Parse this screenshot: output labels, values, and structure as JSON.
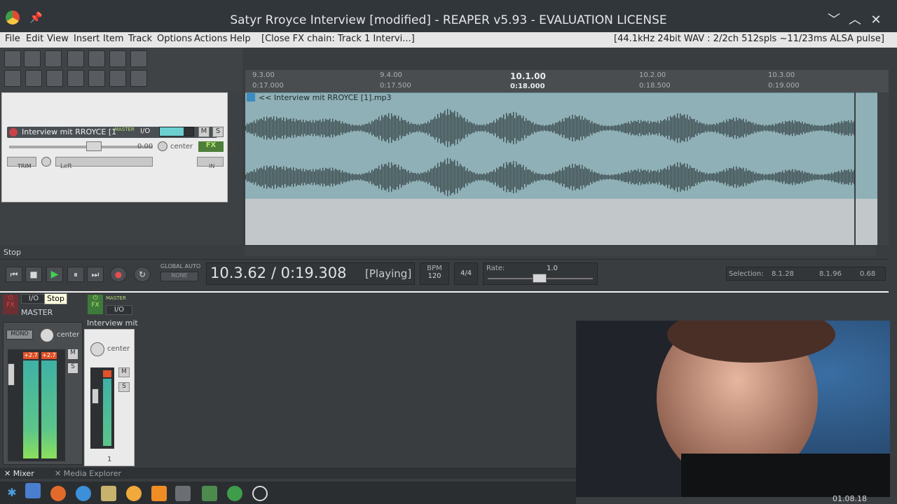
{
  "window": {
    "title": "Satyr Rroyce Interview [modified] - REAPER v5.93 - EVALUATION LICENSE",
    "pin": "📌",
    "controls": [
      "﹀",
      "︿",
      "✕"
    ]
  },
  "menu": {
    "items": [
      "File",
      "Edit",
      "View",
      "Insert",
      "Item",
      "Track",
      "Options",
      "Actions",
      "Help"
    ],
    "close_fx": "[Close FX chain: Track 1 Intervi...]",
    "status": "[44.1kHz 24bit WAV : 2/2ch 512spls ~11/23ms ALSA pulse]"
  },
  "ruler": {
    "ticks": [
      {
        "bar": "9.3.00",
        "time": "0:17.000"
      },
      {
        "bar": "9.4.00",
        "time": "0:17.500"
      },
      {
        "bar": "10.1.00",
        "time": "0:18.000"
      },
      {
        "bar": "10.2.00",
        "time": "0:18.500"
      },
      {
        "bar": "10.3.00",
        "time": "0:19.000"
      }
    ]
  },
  "track": {
    "name": "Interview mit RROYCE [1",
    "master_label": "MASTER",
    "io": "I/O",
    "volume": "0.00",
    "pan": "center",
    "fx": "FX",
    "mute": "M",
    "solo": "S",
    "trim": "TRIM",
    "channel": "Left",
    "index": "1",
    "in_label": "IN"
  },
  "item": {
    "label": "<< Interview mit RROYCE [1].mp3"
  },
  "status_left": "Stop",
  "transport": {
    "global_auto": "GLOBAL AUTO",
    "none": "NONE",
    "time": "10.3.62 / 0:19.308",
    "state": "[Playing]",
    "bpm_label": "BPM",
    "bpm": "120",
    "timesig": "4/4",
    "rate_label": "Rate:",
    "rate": "1.0",
    "selection_label": "Selection:",
    "sel_start": "8.1.28",
    "sel_end": "8.1.96",
    "sel_len": "0.68",
    "tooltip": "Stop"
  },
  "mixer": {
    "master_title": "MASTER",
    "mono": "MONO",
    "pan": "center",
    "peak_l": "+2.7",
    "peak_r": "+2.7",
    "scale": [
      "12",
      "6",
      "0",
      "6",
      "12",
      "18",
      "24",
      "30",
      "36",
      "42"
    ],
    "track_title": "Interview mit",
    "track_pan": "center",
    "track_index": "1",
    "io": "I/O",
    "master_small": "MASTER",
    "tabs": [
      "Mixer",
      "Media Explorer"
    ]
  },
  "clock": "01.08.18"
}
